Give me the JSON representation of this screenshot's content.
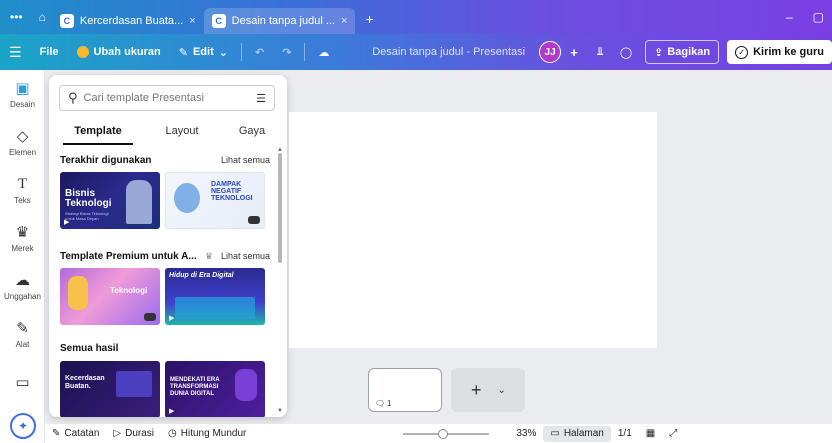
{
  "browser": {
    "tabs": [
      {
        "label": "Kercerdasan Buata...",
        "active": false
      },
      {
        "label": "Desain tanpa judul ...",
        "active": true
      }
    ],
    "new_tab": "+",
    "minimize": "–",
    "maximize": "▢"
  },
  "toolbar": {
    "menu": "☰",
    "file": "File",
    "resize": "Ubah ukuran",
    "edit": "Edit",
    "doc_title": "Desain tanpa judul - Presentasi",
    "avatar": "JJ",
    "share": "Bagikan",
    "send": "Kirim ke guru"
  },
  "sidebar": {
    "items": [
      {
        "label": "Desain",
        "icon": "layout-icon"
      },
      {
        "label": "Elemen",
        "icon": "shapes-icon"
      },
      {
        "label": "Teks",
        "icon": "text-icon"
      },
      {
        "label": "Merek",
        "icon": "brand-icon"
      },
      {
        "label": "Unggahan",
        "icon": "upload-icon"
      },
      {
        "label": "Alat",
        "icon": "draw-icon"
      },
      {
        "label": "",
        "icon": "folder-icon"
      }
    ]
  },
  "panel": {
    "search_placeholder": "Cari template Presentasi",
    "tabs": [
      "Template",
      "Layout",
      "Gaya"
    ],
    "sections": [
      {
        "title": "Terakhir digunakan",
        "link": "Lihat semua",
        "thumbs": [
          {
            "title": "Bisnis Teknologi",
            "subtitle": "Strategi Bisnis Teknologi untuk Masa Depan"
          },
          {
            "title": "DAMPAK NEGATIF TEKNOLOGI",
            "subtitle": ""
          }
        ]
      },
      {
        "title": "Template Premium untuk A...",
        "link": "Lihat semua",
        "thumbs": [
          {
            "title": "Teknologi",
            "subtitle": ""
          },
          {
            "title": "Hidup di Era Digital",
            "subtitle": ""
          }
        ]
      },
      {
        "title": "Semua hasil",
        "link": "",
        "thumbs": [
          {
            "title": "Kecerdasan Buatan.",
            "subtitle": ""
          },
          {
            "title": "MENDEKATI ERA TRANSFORMASI DUNIA DIGITAL",
            "subtitle": ""
          }
        ]
      }
    ]
  },
  "pages": {
    "page_number": "1",
    "add": "+"
  },
  "bottom": {
    "notes": "Catatan",
    "duration": "Durasi",
    "timer": "Hitung Mundur",
    "zoom": "33%",
    "pages_label": "Halaman",
    "page_count": "1/1"
  },
  "colors": {
    "accent": "#7b3fe4",
    "teal": "#1aa4c8",
    "active_tab_icon": "#2aa0d9"
  }
}
